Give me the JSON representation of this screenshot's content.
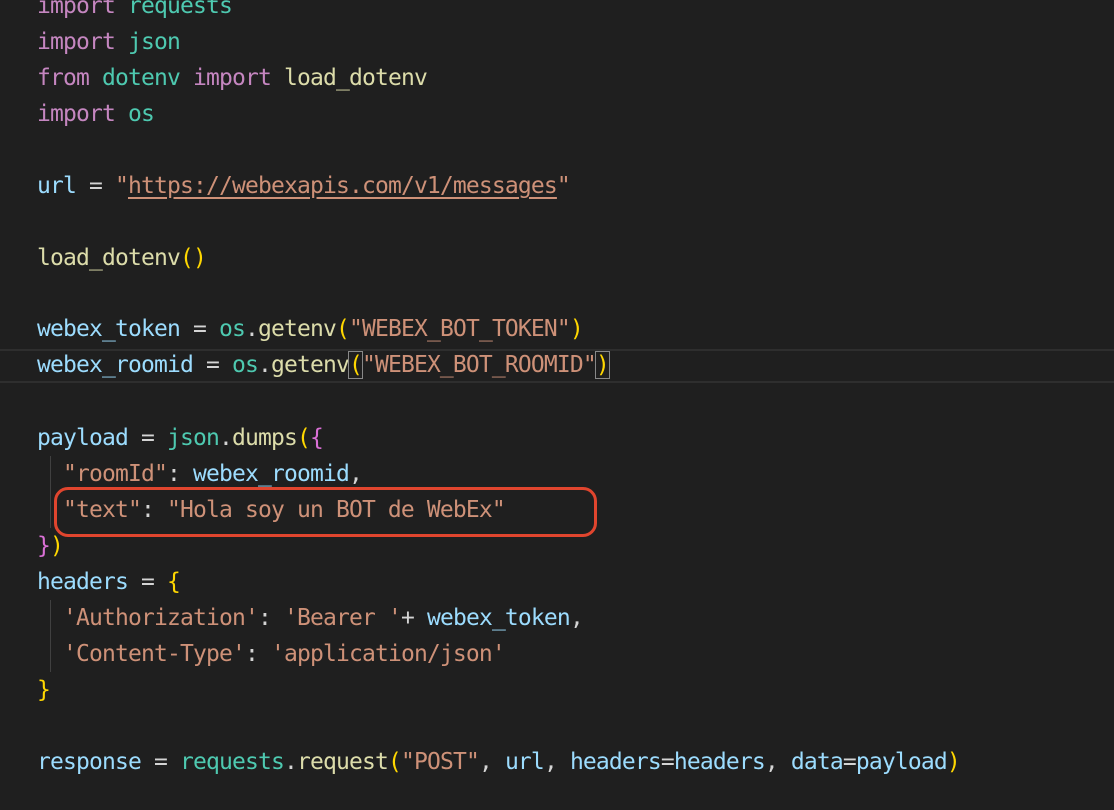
{
  "code": {
    "imp_kw": "import",
    "mod_requests": "requests",
    "mod_json": "json",
    "from_kw": "from",
    "mod_dotenv": "dotenv",
    "fn_load_dotenv": "load_dotenv",
    "mod_os": "os",
    "var_url": "url",
    "eq": "=",
    "url_q1": "\"",
    "url_value": "https://webexapis.com/v1/messages",
    "url_q2": "\"",
    "paren_open": "(",
    "paren_close": ")",
    "var_webex_token": "webex_token",
    "dot": ".",
    "fn_getenv": "getenv",
    "str_bot_token": "\"WEBEX_BOT_TOKEN\"",
    "var_webex_roomid": "webex_roomid",
    "str_bot_roomid": "\"WEBEX_BOT_ROOMID\"",
    "var_payload": "payload",
    "fn_dumps": "dumps",
    "brace_open": "{",
    "brace_close": "}",
    "key_roomId": "\"roomId\"",
    "colon": ":",
    "comma": ",",
    "key_text": "\"text\"",
    "str_hola": "\"Hola soy un BOT de WebEx\"",
    "var_headers": "headers",
    "key_authorization": "'Authorization'",
    "str_bearer": "'Bearer '",
    "plus": "+",
    "key_content_type": "'Content-Type'",
    "str_app_json": "'application/json'",
    "var_response": "response",
    "fn_request": "request",
    "str_post": "\"POST\"",
    "param_headers": "headers",
    "param_data": "data"
  },
  "colors": {
    "background": "#1f1f1f",
    "keyword": "#c586c0",
    "variable": "#9cdcfe",
    "module": "#4ec9b0",
    "function": "#dcdcaa",
    "string": "#ce9178",
    "bracket_level1": "#ffd700",
    "bracket_level2": "#da70d6",
    "annotation_box": "#e0452e"
  }
}
